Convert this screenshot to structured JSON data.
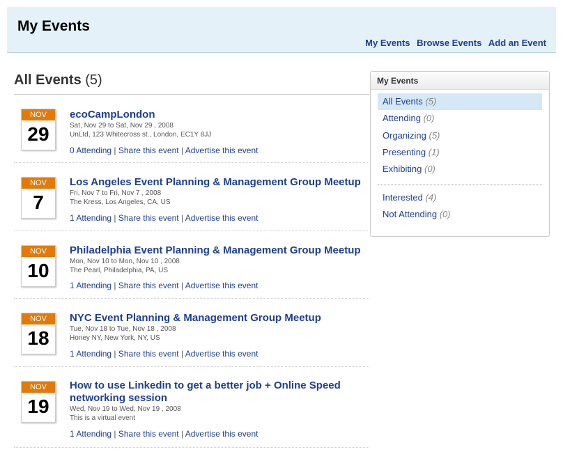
{
  "header": {
    "title": "My Events",
    "nav": [
      "My Events",
      "Browse Events",
      "Add an Event"
    ]
  },
  "main": {
    "title": "All Events",
    "count": "(5)"
  },
  "events": [
    {
      "month": "NOV",
      "day": "29",
      "title_lines": [
        "ecoCampLondon"
      ],
      "date": "Sat, Nov 29 to Sat, Nov 29 , 2008",
      "location": "UnLtd, 123 Whitecross st., London, EC1Y 8JJ",
      "attending": "0 Attending",
      "share": "Share this event",
      "advertise": "Advertise this event"
    },
    {
      "month": "NOV",
      "day": "7",
      "title_lines": [
        "Los Angeles Event Planning & Management Group Meetup"
      ],
      "date": "Fri, Nov 7 to Fri, Nov 7 , 2008",
      "location": "The Kress, Los Angeles, CA, US",
      "attending": "1 Attending",
      "share": "Share this event",
      "advertise": "Advertise this event"
    },
    {
      "month": "NOV",
      "day": "10",
      "title_lines": [
        "Philadelphia Event Planning & Management Group Meetup"
      ],
      "date": "Mon, Nov 10 to Mon, Nov 10 , 2008",
      "location": "The Pearl, Philadelphia, PA, US",
      "attending": "1 Attending",
      "share": "Share this event",
      "advertise": "Advertise this event"
    },
    {
      "month": "NOV",
      "day": "18",
      "title_lines": [
        "NYC Event Planning & Management Group Meetup"
      ],
      "date": "Tue, Nov 18 to Tue, Nov 18 , 2008",
      "location": "Honey NY, New York, NY, US",
      "attending": "1 Attending",
      "share": "Share this event",
      "advertise": "Advertise this event"
    },
    {
      "month": "NOV",
      "day": "19",
      "title_lines": [
        "How to use Linkedin to get a better job + Online Speed",
        "networking session"
      ],
      "date": "Wed, Nov 19 to Wed, Nov 19 , 2008",
      "location": "This is a virtual event",
      "attending": "1 Attending",
      "share": "Share this event",
      "advertise": "Advertise this event"
    }
  ],
  "sidebar": {
    "title": "My Events",
    "items": [
      {
        "label": "All Events",
        "count": "(5)"
      },
      {
        "label": "Attending",
        "count": "(0)"
      },
      {
        "label": "Organizing",
        "count": "(5)"
      },
      {
        "label": "Presenting",
        "count": "(1)"
      },
      {
        "label": "Exhibiting",
        "count": "(0)"
      },
      {
        "label": "Interested",
        "count": "(4)"
      },
      {
        "label": "Not Attending",
        "count": "(0)"
      }
    ]
  },
  "colors": {
    "header_bg": "#e4f1f9",
    "link": "#1d3f8f",
    "calendar_month": "#e17a0a",
    "sidebar_active": "#d4e8f7"
  }
}
